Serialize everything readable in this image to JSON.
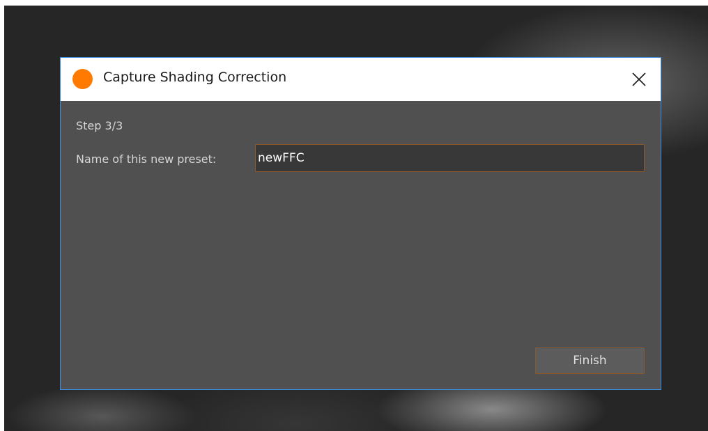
{
  "dialog": {
    "title": "Capture Shading Correction",
    "accent_color": "#ff7a00",
    "border_color": "#3c8fde",
    "icons": {
      "app": "orange-circle-icon",
      "close": "close-icon"
    }
  },
  "content": {
    "step_label": "Step 3/3",
    "name_label": "Name of this new preset:",
    "name_value": "newFFC"
  },
  "footer": {
    "finish_label": "Finish"
  }
}
